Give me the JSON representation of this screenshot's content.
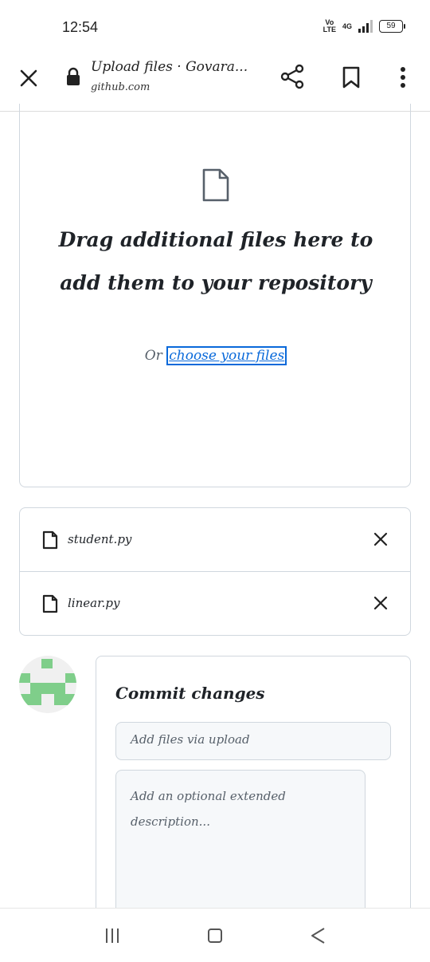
{
  "status_bar": {
    "time": "12:54",
    "volte_top": "Vo",
    "volte_bottom": "LTE",
    "network": "4G",
    "battery": "59"
  },
  "browser": {
    "page_title": "Upload files · Govara...",
    "domain": "github.com"
  },
  "dropzone": {
    "heading": "Drag additional files here to add them to your repository",
    "or_text": "Or",
    "choose_link": "choose your files"
  },
  "files": [
    {
      "name": "student.py"
    },
    {
      "name": "linear.py"
    }
  ],
  "commit": {
    "title": "Commit changes",
    "summary_placeholder": "Add files via upload",
    "description_placeholder": "Add an optional extended description..."
  },
  "colors": {
    "link": "#0969da",
    "border": "#d0d7de",
    "field_bg": "#f6f8fa",
    "avatar_green": "#7fce8a"
  },
  "icons": [
    "close-icon",
    "lock-icon",
    "share-icon",
    "bookmark-icon",
    "more-options-icon",
    "file-icon",
    "remove-file-icon",
    "recents-icon",
    "home-icon",
    "back-icon"
  ]
}
